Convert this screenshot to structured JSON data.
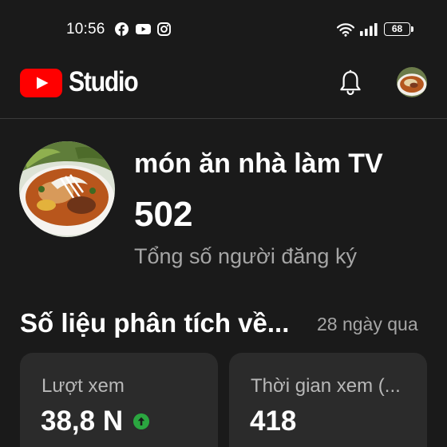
{
  "status_bar": {
    "time": "10:56",
    "battery": "68",
    "app_icons": [
      "facebook-icon",
      "youtube-icon",
      "instagram-icon"
    ]
  },
  "header": {
    "app_name": "Studio",
    "logo": "youtube-logo",
    "notification_icon": "bell-icon",
    "brand_color": "#ff0000"
  },
  "channel": {
    "name": "món ăn nhà làm TV",
    "subscribers": "502",
    "subscribers_label": "Tổng số người đăng ký"
  },
  "analytics": {
    "title": "Số liệu phân tích về...",
    "period": "28 ngày qua",
    "metrics": [
      {
        "label": "Lượt xem",
        "value": "38,8 N",
        "trend": "up",
        "trend_color": "#2ba640"
      },
      {
        "label": "Thời gian xem (...",
        "value": "418"
      }
    ]
  }
}
